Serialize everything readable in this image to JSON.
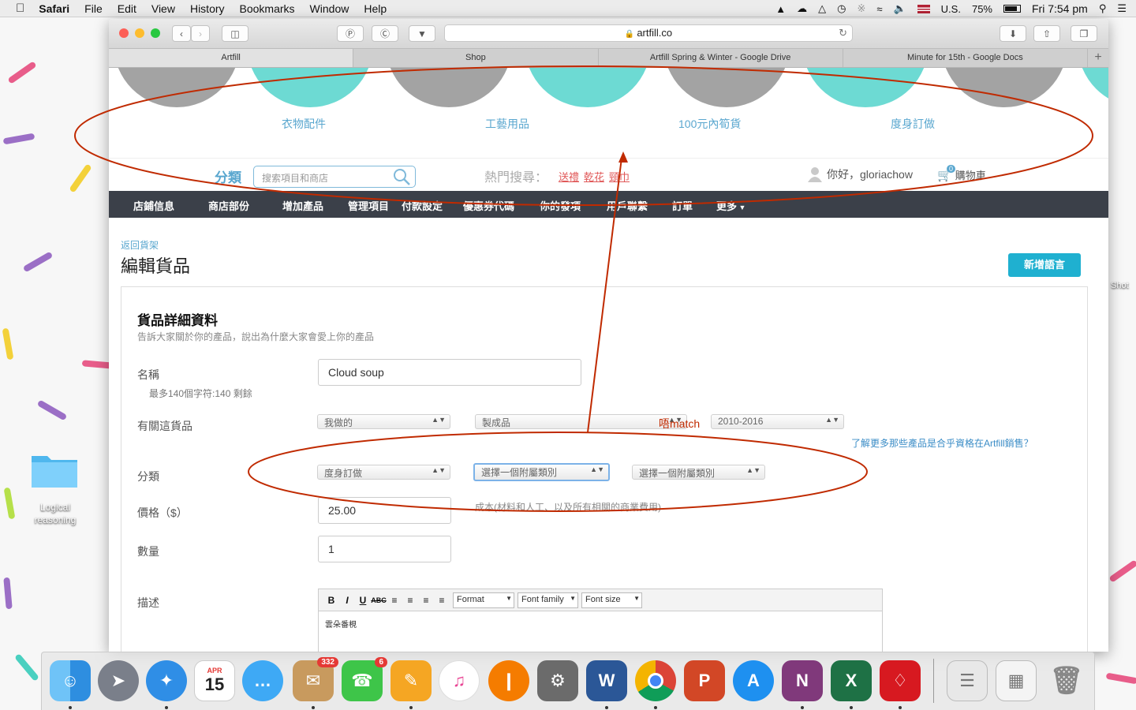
{
  "menubar": {
    "app": "Safari",
    "items": [
      "File",
      "Edit",
      "View",
      "History",
      "Bookmarks",
      "Window",
      "Help"
    ],
    "status": {
      "input_source": "U.S.",
      "battery": "75%",
      "clock": "Fri 7:54 pm"
    }
  },
  "browser": {
    "url": "artfill.co",
    "tabs": [
      "Artfill",
      "Shop",
      "Artfill Spring & Winter - Google Drive",
      "Minute for 15th - Google Docs"
    ],
    "active_tab": 0
  },
  "site": {
    "categories": [
      "衣物配件",
      "工藝用品",
      "100元內筍貨",
      "度身訂做"
    ],
    "search": {
      "label": "分類",
      "placeholder": "搜索項目和商店"
    },
    "hot": {
      "label": "熱門搜尋：",
      "links": [
        "送禮",
        "乾花",
        "頸巾"
      ]
    },
    "user": {
      "greeting": "你好，gloriachow"
    },
    "cart": {
      "count": "0",
      "label": "購物車"
    },
    "nav": [
      "店鋪信息",
      "商店部份",
      "增加產品",
      "管理項目",
      "付款設定",
      "優惠券代碼",
      "你的發項",
      "用戶聯繫",
      "訂單",
      "更多"
    ]
  },
  "editor_page": {
    "back_link": "返回貨架",
    "title": "編輯貨品",
    "add_language": "新增語言",
    "panel_title": "貨品詳細資料",
    "panel_subtitle": "告訴大家關於你的產品，說出為什麼大家會愛上你的產品",
    "name": {
      "label": "名稱",
      "value": "Cloud soup",
      "hint": "最多140個字符:140 剩餘"
    },
    "about": {
      "label": "有關這貨品",
      "selects": [
        "我做的",
        "製成品",
        "2010-2016"
      ],
      "info_link": "了解更多那些產品是合乎資格在Artfill銷售？"
    },
    "category": {
      "label": "分類",
      "selects": [
        "度身訂做",
        "選擇一個附屬類別",
        "選擇一個附屬類別"
      ]
    },
    "price": {
      "label": "價格（$）",
      "value": "25.00",
      "note": "成本(材料和人工、以及所有相關的商業費用)"
    },
    "quantity": {
      "label": "數量",
      "value": "1"
    },
    "description": {
      "label": "描述",
      "toolbar_format": "Format",
      "toolbar_font_family": "Font family",
      "toolbar_font_size": "Font size",
      "content": "雲朵番梘"
    }
  },
  "annotation": {
    "text": "唔match",
    "color": "#c02a00"
  },
  "desktop": {
    "folder_label": "Logical reasoning"
  },
  "dock": {
    "calendar_month": "APR",
    "calendar_day": "15",
    "badges": {
      "mail": "332",
      "facetime": "6"
    },
    "apps": [
      "Finder",
      "Launchpad",
      "Safari",
      "Calendar",
      "Messages",
      "Mail",
      "FaceTime",
      "Pages",
      "iTunes",
      "iBooks",
      "System Preferences",
      "Word",
      "Chrome",
      "PowerPoint",
      "App Store",
      "OneNote",
      "Excel",
      "Acrobat",
      "Notes",
      "Preview",
      "Trash"
    ]
  },
  "colors": {
    "accent": "#5aa7cf",
    "nav_bg": "#3b4049",
    "button": "#1fb0d0",
    "annotation": "#c02a00"
  }
}
